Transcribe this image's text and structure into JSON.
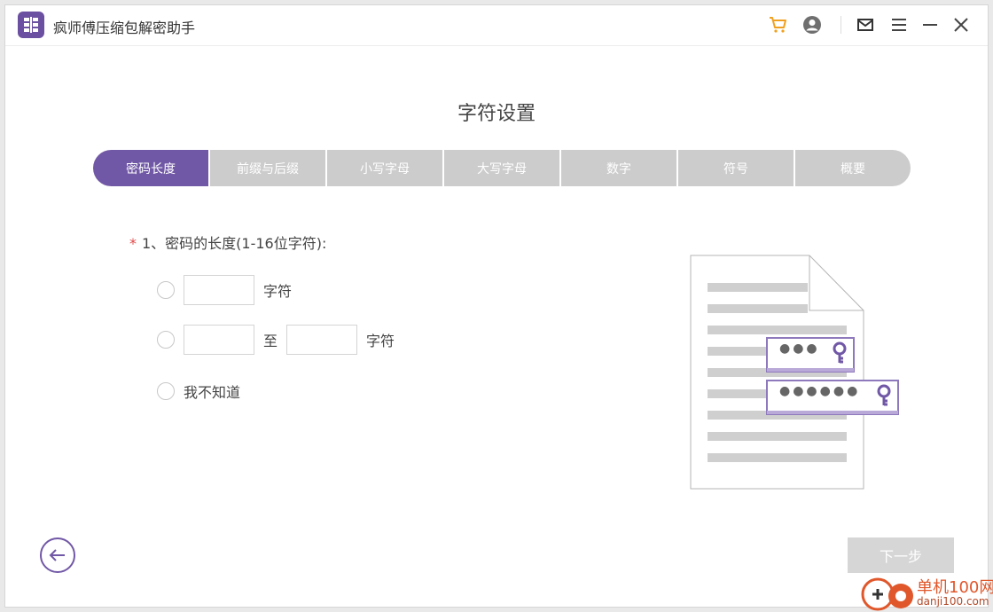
{
  "app": {
    "title": "疯师傅压缩包解密助手"
  },
  "titlebar": {
    "icons": [
      "cart-icon",
      "user-icon",
      "mail-icon",
      "menu-icon",
      "minimize-icon",
      "close-icon"
    ],
    "cart_color": "#f0a020"
  },
  "page": {
    "title": "字符设置"
  },
  "steps": [
    {
      "label": "密码长度",
      "active": true
    },
    {
      "label": "前缀与后缀",
      "active": false
    },
    {
      "label": "小写字母",
      "active": false
    },
    {
      "label": "大写字母",
      "active": false
    },
    {
      "label": "数字",
      "active": false
    },
    {
      "label": "符号",
      "active": false
    },
    {
      "label": "概要",
      "active": false
    }
  ],
  "question": {
    "required_mark": "*",
    "label": "1、密码的长度(1-16位字符):"
  },
  "options": {
    "exact": {
      "value": "",
      "suffix": "字符"
    },
    "range": {
      "from_value": "",
      "separator": "至",
      "to_value": "",
      "suffix": "字符"
    },
    "unknown": {
      "label": "我不知道"
    }
  },
  "illustration": {
    "short_password_mask": "●●●",
    "long_password_mask": "●●●●●●"
  },
  "footer": {
    "next_label": "下一步"
  },
  "watermark": {
    "name": "单机100网",
    "url": "danji100.com"
  },
  "colors": {
    "accent": "#7158a6",
    "inactive_step": "#cccccc",
    "required": "#e04848",
    "disabled_button": "#d6d6d6"
  }
}
